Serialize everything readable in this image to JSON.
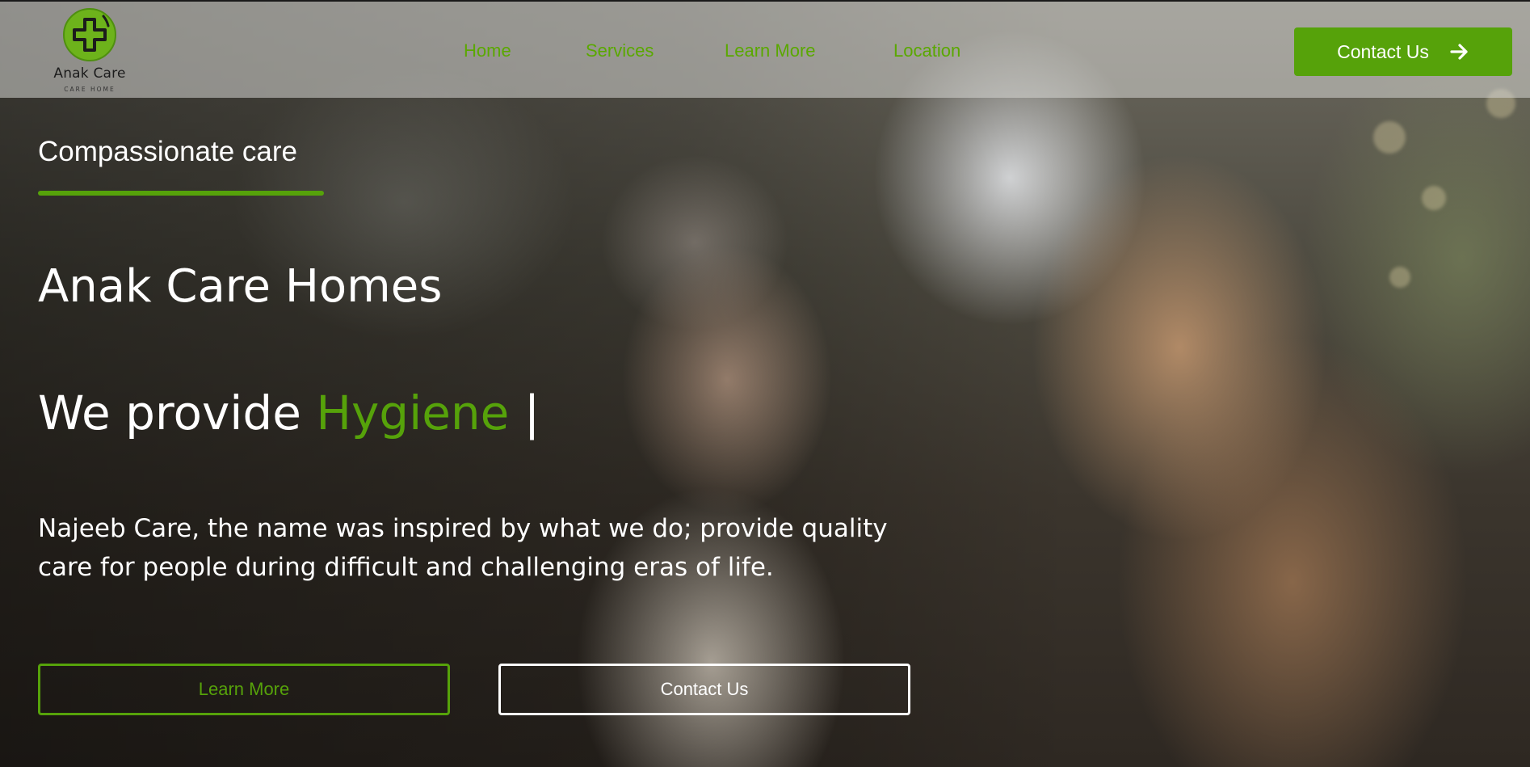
{
  "brand": {
    "name": "Anak Care",
    "subtitle": "CARE HOME",
    "accent_color": "#56a20a"
  },
  "nav": {
    "items": [
      {
        "label": "Home"
      },
      {
        "label": "Services"
      },
      {
        "label": "Learn More"
      },
      {
        "label": "Location"
      }
    ],
    "cta_label": "Contact Us",
    "cta_icon": "arrow-right-icon"
  },
  "hero": {
    "tagline": "Compassionate care",
    "title": "Anak Care Homes",
    "typed_prefix": "We provide",
    "typed_word": "Hygiene",
    "typed_cursor": "|",
    "description": "Najeeb Care, the name was inspired by what we do; provide quality care for people during difficult and challenging eras of life.",
    "primary_button": "Learn More",
    "secondary_button": "Contact Us"
  }
}
